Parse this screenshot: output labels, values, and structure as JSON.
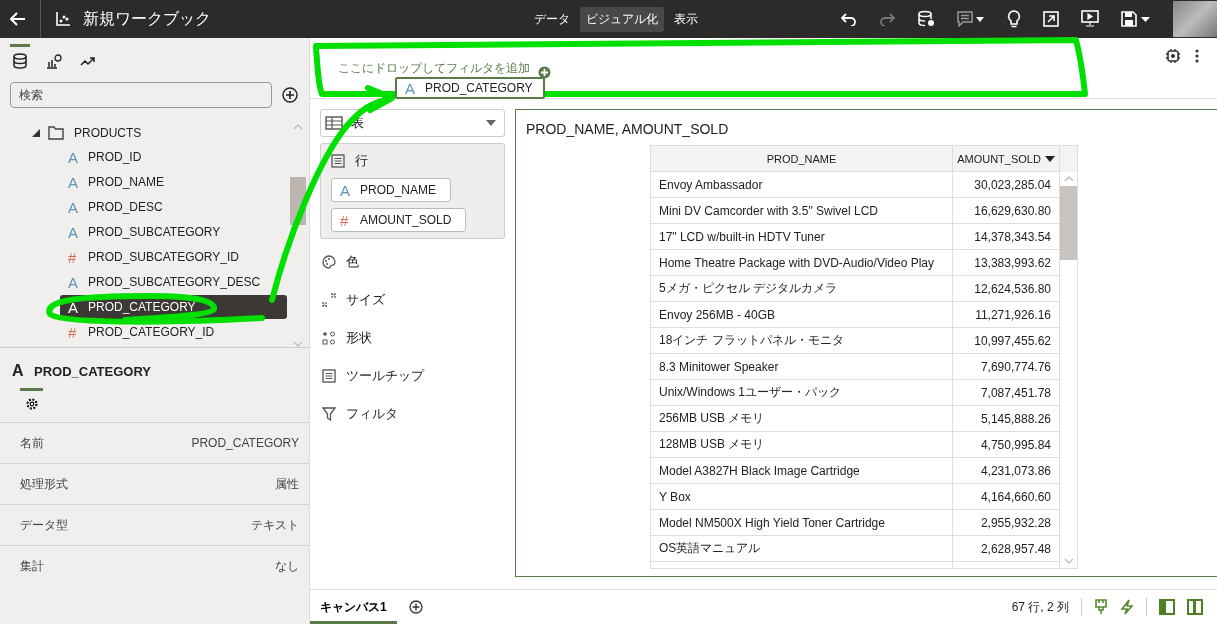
{
  "header": {
    "title": "新規ワークブック",
    "tabs": [
      {
        "label": "データ",
        "selected": false
      },
      {
        "label": "ビジュアル化",
        "selected": true
      },
      {
        "label": "表示",
        "selected": false
      }
    ],
    "redo_disabled": true
  },
  "data_panel": {
    "tabs": [
      {
        "kind": "data",
        "selected": true
      },
      {
        "kind": "viz",
        "selected": false
      },
      {
        "kind": "analytics",
        "selected": false
      }
    ],
    "search": {
      "placeholder": "検索"
    },
    "tree": [
      {
        "label": "PRODUCTS",
        "kind": "folder",
        "expanded": true,
        "children": [
          {
            "label": "PROD_ID",
            "icon": "A",
            "kind": "attribute",
            "selected": false
          },
          {
            "label": "PROD_NAME",
            "icon": "A",
            "kind": "attribute",
            "selected": false
          },
          {
            "label": "PROD_DESC",
            "icon": "A",
            "kind": "attribute",
            "selected": false
          },
          {
            "label": "PROD_SUBCATEGORY",
            "icon": "A",
            "kind": "attribute",
            "selected": false
          },
          {
            "label": "PROD_SUBCATEGORY_ID",
            "icon": "#",
            "kind": "measure",
            "selected": false
          },
          {
            "label": "PROD_SUBCATEGORY_DESC",
            "icon": "A",
            "kind": "attribute",
            "selected": false
          },
          {
            "label": "PROD_CATEGORY",
            "icon": "A",
            "kind": "attribute",
            "selected": true
          },
          {
            "label": "PROD_CATEGORY_ID",
            "icon": "#",
            "kind": "measure",
            "selected": false
          }
        ]
      }
    ]
  },
  "properties": {
    "title": "PROD_CATEGORY",
    "icon": "A",
    "rows": [
      {
        "label": "名前",
        "value": "PROD_CATEGORY"
      },
      {
        "label": "処理形式",
        "value": "属性"
      },
      {
        "label": "データ型",
        "value": "テキスト"
      },
      {
        "label": "集計",
        "value": "なし"
      }
    ]
  },
  "filter_bar": {
    "placeholder": "ここにドロップしてフィルタを追加",
    "dragged": {
      "label": "PROD_CATEGORY",
      "icon": "A",
      "kind": "attribute"
    }
  },
  "grammar": {
    "viz_type": "表",
    "rows_section": {
      "label": "行",
      "chips": [
        {
          "label": "PROD_NAME",
          "icon": "A",
          "kind": "attribute"
        },
        {
          "label": "AMOUNT_SOLD",
          "icon": "#",
          "kind": "measure"
        }
      ]
    },
    "sections": [
      {
        "label": "色",
        "kind": "color"
      },
      {
        "label": "サイズ",
        "kind": "size"
      },
      {
        "label": "形状",
        "kind": "shape"
      },
      {
        "label": "ツールチップ",
        "kind": "tooltip"
      },
      {
        "label": "フィルタ",
        "kind": "filter"
      }
    ]
  },
  "visualization": {
    "title": "PROD_NAME, AMOUNT_SOLD",
    "columns": [
      "PROD_NAME",
      "AMOUNT_SOLD"
    ],
    "rows": [
      [
        "Envoy Ambassador",
        "30,023,285.04"
      ],
      [
        "Mini DV Camcorder with 3.5\" Swivel LCD",
        "16,629,630.80"
      ],
      [
        "17\" LCD w/built-in HDTV Tuner",
        "14,378,343.54"
      ],
      [
        "Home Theatre Package with DVD-Audio/Video Play",
        "13,383,993.62"
      ],
      [
        "5メガ・ピクセル デジタルカメラ",
        "12,624,536.80"
      ],
      [
        "Envoy 256MB - 40GB",
        "11,271,926.16"
      ],
      [
        "18インチ フラットパネル・モニタ",
        "10,997,455.62"
      ],
      [
        "8.3 Minitower Speaker",
        "7,690,774.76"
      ],
      [
        "Unix/Windows 1ユーザー・パック",
        "7,087,451.78"
      ],
      [
        "256MB USB メモリ",
        "5,145,888.26"
      ],
      [
        "128MB USB メモリ",
        "4,750,995.84"
      ],
      [
        "Model A3827H Black Image Cartridge",
        "4,231,073.86"
      ],
      [
        "Y Box",
        "4,164,660.60"
      ],
      [
        "Model NM500X High Yield Toner Cartridge",
        "2,955,932.28"
      ],
      [
        "OS英語マニュアル",
        "2,628,957.48"
      ]
    ]
  },
  "footer": {
    "tabs": [
      {
        "label": "キャンバス1",
        "selected": true
      }
    ],
    "status": "67 行, 2 列"
  }
}
